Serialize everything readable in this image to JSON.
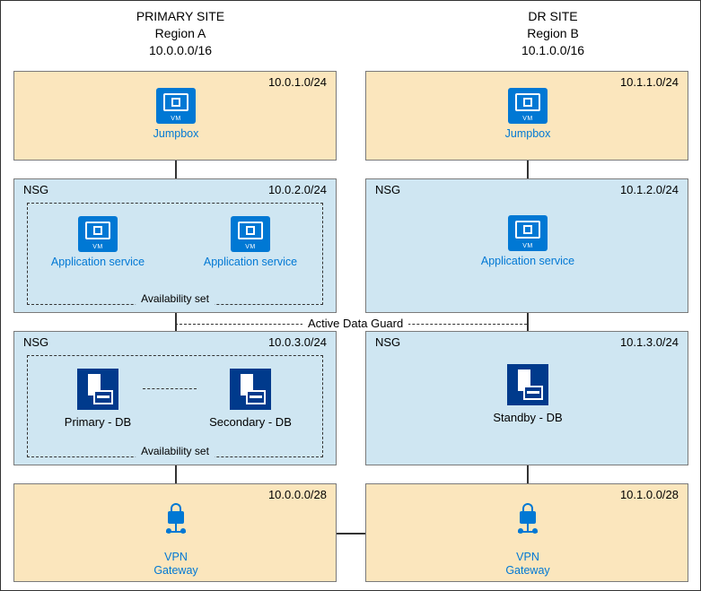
{
  "primary": {
    "title": "PRIMARY SITE",
    "region": "Region A",
    "cidr": "10.0.0.0/16",
    "zones": {
      "jumpbox": {
        "cidr": "10.0.1.0/24",
        "label": "Jumpbox"
      },
      "app": {
        "nsg": "NSG",
        "cidr": "10.0.2.0/24",
        "avail": "Availability set",
        "label": "Application service"
      },
      "db": {
        "nsg": "NSG",
        "cidr": "10.0.3.0/24",
        "avail": "Availability set",
        "primary": "Primary - DB",
        "secondary": "Secondary - DB"
      },
      "vpn": {
        "cidr": "10.0.0.0/28",
        "label1": "VPN",
        "label2": "Gateway"
      }
    }
  },
  "dr": {
    "title": "DR SITE",
    "region": "Region B",
    "cidr": "10.1.0.0/16",
    "zones": {
      "jumpbox": {
        "cidr": "10.1.1.0/24",
        "label": "Jumpbox"
      },
      "app": {
        "nsg": "NSG",
        "cidr": "10.1.2.0/24",
        "label": "Application service"
      },
      "db": {
        "nsg": "NSG",
        "cidr": "10.1.3.0/24",
        "standby": "Standby - DB"
      },
      "vpn": {
        "cidr": "10.1.0.0/28",
        "label1": "VPN",
        "label2": "Gateway"
      }
    }
  },
  "adg": "Active Data Guard"
}
